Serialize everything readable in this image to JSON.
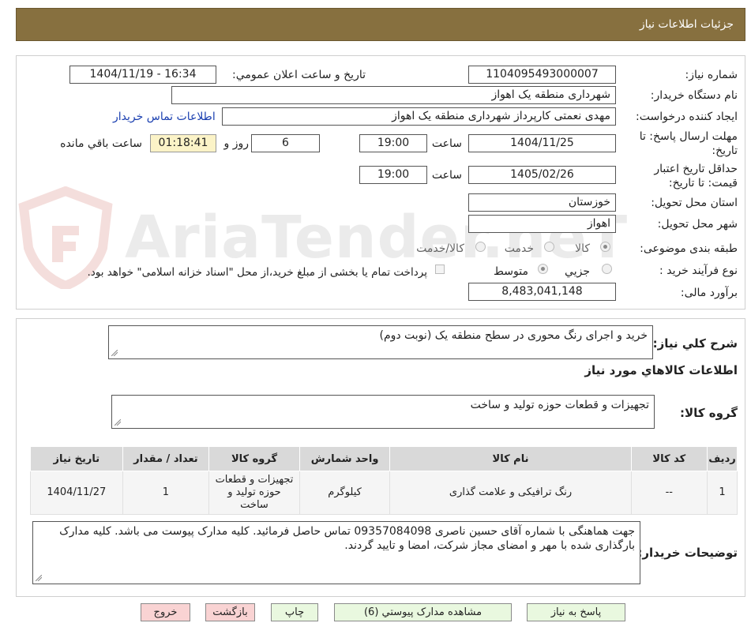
{
  "header": {
    "title": "جزئیات اطلاعات نیاز"
  },
  "watermark": {
    "text": "AriaTender.neT"
  },
  "info": {
    "need_number_label": "شماره نیاز:",
    "need_number": "1104095493000007",
    "announce_label": "تاریخ و ساعت اعلان عمومي:",
    "announce_value": "1404/11/19 - 16:34",
    "buyer_org_label": "نام دستگاه خريدار:",
    "buyer_org": "شهرداری منطقه یک اهواز",
    "creator_label": "ايجاد کننده درخواست:",
    "creator": "مهدی نعمتی کارپرداز شهرداری منطقه یک اهواز",
    "contact_link": "اطلاعات تماس خريدار",
    "deadline_label_1": "مهلت ارسال پاسخ: تا",
    "deadline_label_2": "تاريخ:",
    "deadline_date": "1404/11/25",
    "time_label": "ساعت",
    "deadline_time": "19:00",
    "days_value": "6",
    "days_label": "روز و",
    "remaining_time": "01:18:41",
    "remaining_label": "ساعت باقي مانده",
    "validity_label_1": "حداقل تاريخ اعتبار",
    "validity_label_2": "قيمت: تا تاريخ:",
    "validity_date": "1405/02/26",
    "validity_time": "19:00",
    "province_label": "استان محل تحويل:",
    "province": "خوزستان",
    "city_label": "شهر محل تحويل:",
    "city": "اهواز",
    "category_label": "طبقه بندی موضوعی:",
    "category_options": [
      "کالا",
      "خدمت",
      "کالا/خدمت"
    ],
    "process_label": "نوع فرآيند خريد :",
    "process_options": [
      "جزيي",
      "متوسط"
    ],
    "payment_note": "پرداخت تمام یا بخشی از مبلغ خرید،از محل \"اسناد خزانه اسلامی\" خواهد بود.",
    "budget_label": "برآورد مالی:",
    "budget": "8,483,041,148"
  },
  "details": {
    "summary_label": "شرح کلي نياز:",
    "summary": "خرید و اجرای رنگ محوری در سطح منطقه یک (نوبت دوم)",
    "goods_info_title": "اطلاعات کالاهاي مورد نياز",
    "goods_group_label": "گروه کالا:",
    "goods_group": "تجهیزات و قطعات حوزه تولید و ساخت",
    "table": {
      "headers": [
        "رديف",
        "کد کالا",
        "نام کالا",
        "واحد شمارش",
        "گروه کالا",
        "تعداد / مقدار",
        "تاريخ نياز"
      ],
      "rows": [
        [
          "1",
          "--",
          "رنگ ترافیکی و علامت گذاری",
          "کیلوگرم",
          "تجهیزات و قطعات حوزه تولید و ساخت",
          "1",
          "1404/11/27"
        ]
      ]
    },
    "buyer_notes_label": "توضيحات خريدار:",
    "buyer_notes": "جهت هماهنگی با شماره آقای حسین ناصری 09357084098 تماس حاصل فرمائید. کلیه مدارک پیوست می باشد. کلیه مدارک بارگذاری شده با مهر و امضای مجاز شرکت، امضا و تایید گردند."
  },
  "buttons": {
    "reply": "پاسخ به نياز",
    "attachments": "مشاهده مدارک پيوستي (6)",
    "print": "چاپ",
    "back": "بازگشت",
    "exit": "خروج"
  }
}
